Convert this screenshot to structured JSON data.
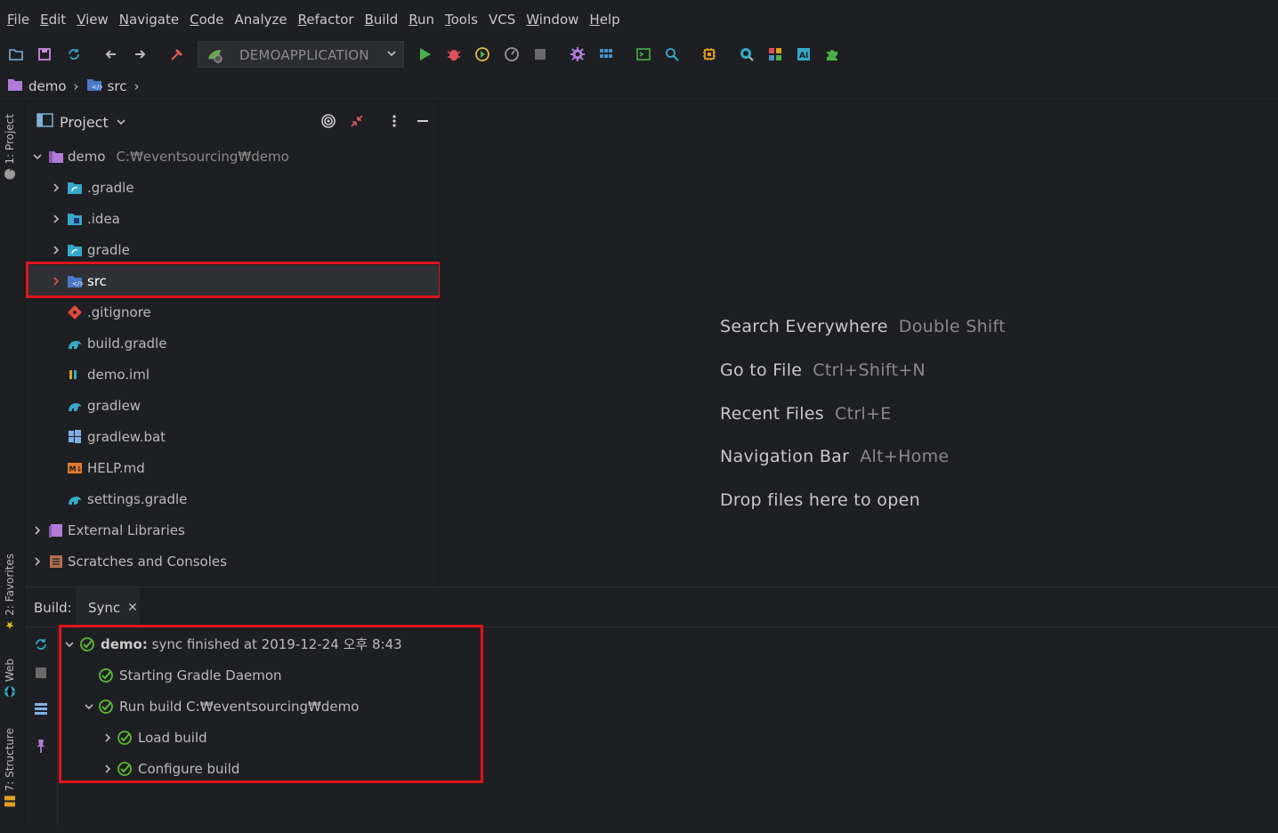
{
  "menu": [
    {
      "mnemonic": "F",
      "rest": "ile"
    },
    {
      "mnemonic": "E",
      "rest": "dit"
    },
    {
      "mnemonic": "V",
      "rest": "iew"
    },
    {
      "mnemonic": "N",
      "rest": "avigate"
    },
    {
      "mnemonic": "C",
      "rest": "ode"
    },
    {
      "mnemonic": "",
      "rest": "Analyze",
      "under": "z"
    },
    {
      "mnemonic": "R",
      "rest": "efactor"
    },
    {
      "mnemonic": "B",
      "rest": "uild"
    },
    {
      "mnemonic": "R",
      "rest": "un",
      "under2": true
    },
    {
      "mnemonic": "T",
      "rest": "ools"
    },
    {
      "mnemonic": "",
      "rest": "VCS"
    },
    {
      "mnemonic": "W",
      "rest": "indow"
    },
    {
      "mnemonic": "H",
      "rest": "elp"
    }
  ],
  "toolbar": {
    "run_config": "DEMOAPPLICATION"
  },
  "breadcrumb": {
    "project": "demo",
    "folder": "src"
  },
  "left_stripe": {
    "project_tab": "1: Project",
    "favorites_tab": "2: Favorites",
    "web_tab": "Web",
    "structure_tab": "7: Structure"
  },
  "project_panel": {
    "title": "Project",
    "tree": [
      {
        "label": "demo",
        "path": "C:₩eventsourcing₩demo"
      },
      {
        "label": ".gradle"
      },
      {
        "label": ".idea"
      },
      {
        "label": "gradle"
      },
      {
        "label": "src"
      },
      {
        "label": ".gitignore"
      },
      {
        "label": "build.gradle"
      },
      {
        "label": "demo.iml"
      },
      {
        "label": "gradlew"
      },
      {
        "label": "gradlew.bat"
      },
      {
        "label": "HELP.md"
      },
      {
        "label": "settings.gradle"
      },
      {
        "label": "External Libraries"
      },
      {
        "label": "Scratches and Consoles"
      }
    ]
  },
  "editor_hints": [
    {
      "action": "Search Everywhere",
      "key": "Double Shift"
    },
    {
      "action": "Go to File",
      "key": "Ctrl+Shift+N"
    },
    {
      "action": "Recent Files",
      "key": "Ctrl+E"
    },
    {
      "action": "Navigation Bar",
      "key": "Alt+Home"
    },
    {
      "action": "Drop files here to open",
      "key": ""
    }
  ],
  "build_panel": {
    "label": "Build:",
    "tab": "Sync",
    "rows": [
      {
        "bold": "demo:",
        "text": "sync finished at 2019-12-24 오후 8:43"
      },
      {
        "text": "Starting Gradle Daemon"
      },
      {
        "text": "Run build C:₩eventsourcing₩demo"
      },
      {
        "text": "Load build"
      },
      {
        "text": "Configure build"
      }
    ]
  },
  "colors": {
    "highlight": "#e0141e",
    "check": "#5fb832",
    "folder_blue": "#4a90c8",
    "project_purple": "#b07cd8"
  }
}
